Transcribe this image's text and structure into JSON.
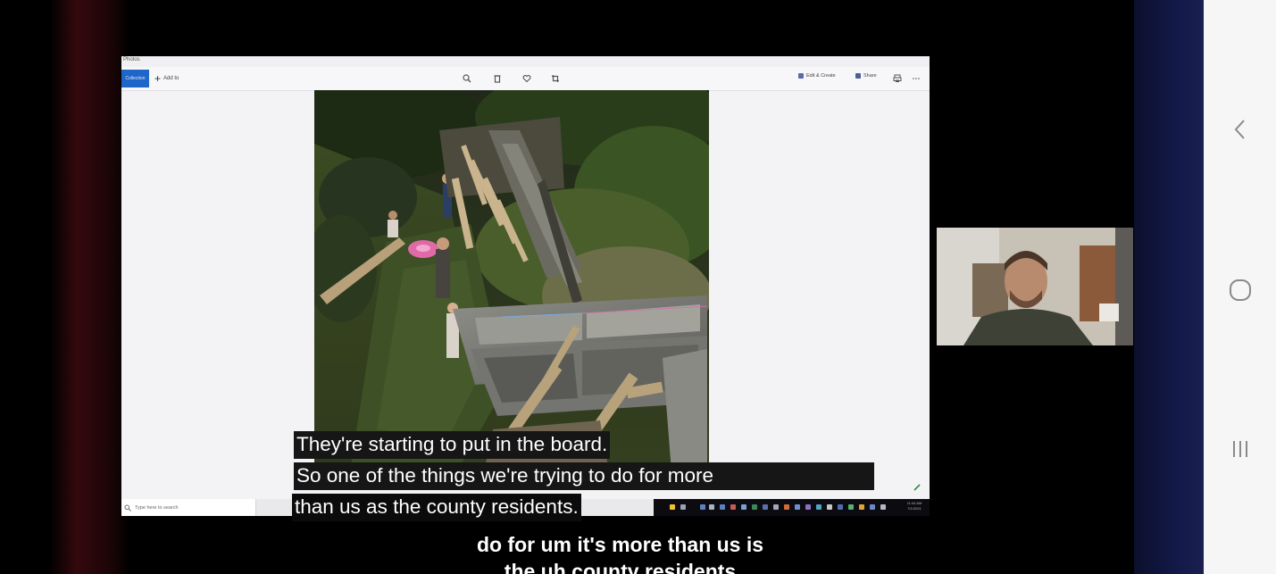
{
  "shared_screen": {
    "app_title": "Photos",
    "toolbar": {
      "collection_label": "Collection",
      "add_label": "Add to",
      "edit_create_label": "Edit & Create",
      "share_label": "Share",
      "icons": [
        "zoom-in-icon",
        "delete-icon",
        "favorite-icon",
        "crop-icon",
        "print-icon",
        "more-icon"
      ]
    },
    "taskbar": {
      "search_placeholder": "Type here to search",
      "clock": "11:04 AM",
      "date": "7/1/2021"
    }
  },
  "video_captions": [
    "They're starting to put in the board.",
    "So one of the things we're trying to do for more",
    "than us as the county residents."
  ],
  "live_caption": [
    "do for um it's more than us is",
    "the uh county residents"
  ],
  "nav": {
    "back": "back-icon",
    "home": "home-icon",
    "recents": "recents-icon"
  },
  "colors": {
    "nav_bar": "#f6f6f6",
    "nav_icon": "#8a8a8a",
    "right_band": "#121846",
    "caption_bg": "#161616",
    "accent_blue": "#1f66c9"
  }
}
